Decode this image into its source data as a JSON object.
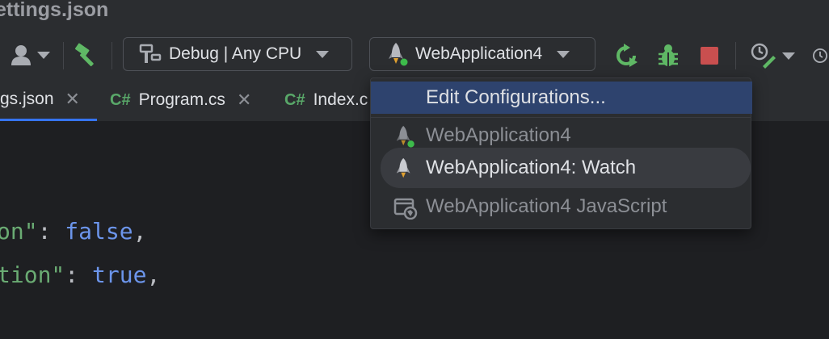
{
  "window": {
    "title": "ettings.json"
  },
  "toolbar": {
    "configuration": "Debug | Any CPU",
    "run_configuration": "WebApplication4"
  },
  "tabs": [
    {
      "label": "gs.json",
      "close": "✕",
      "lang": ""
    },
    {
      "label": "Program.cs",
      "close": "✕",
      "lang": "C#"
    },
    {
      "label": "Index.c",
      "close": "",
      "lang": "C#"
    }
  ],
  "editor": {
    "lines": [
      {
        "key": "on\"",
        "sep": ": ",
        "value": "false",
        "end": ","
      },
      {
        "key": "tion\"",
        "sep": ": ",
        "value": "true",
        "end": ","
      }
    ]
  },
  "dropdown": {
    "header": "Edit Configurations...",
    "items": [
      {
        "label": "WebApplication4",
        "icon": "rocket-running-icon",
        "dim": true
      },
      {
        "label": "WebApplication4: Watch",
        "icon": "rocket-icon",
        "dim": false
      },
      {
        "label": "WebApplication4 JavaScript",
        "icon": "browser-globe-icon",
        "dim": true
      }
    ]
  },
  "colors": {
    "accent": "#3574f0",
    "selection": "#2e436e",
    "run_green": "#5fb865",
    "debug_green": "#5fb865",
    "stop_red": "#c94f4f",
    "string": "#6aab73",
    "keyword": "#6c95eb"
  }
}
